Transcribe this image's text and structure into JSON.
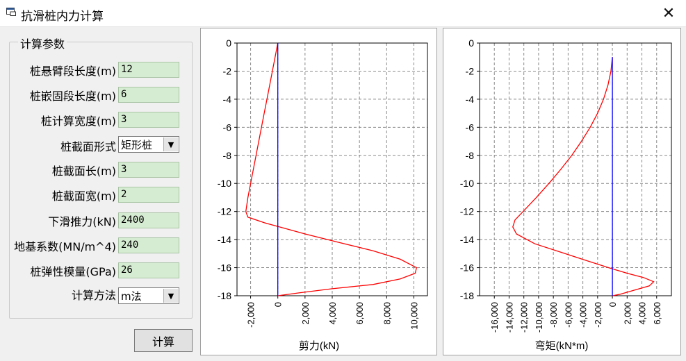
{
  "window": {
    "title": "抗滑桩内力计算",
    "close_label": "✕"
  },
  "params": {
    "group_title": "计算参数",
    "fields": [
      {
        "label": "桩悬臂段长度(m)",
        "value": "12"
      },
      {
        "label": "桩嵌固段长度(m)",
        "value": "6"
      },
      {
        "label": "桩计算宽度(m)",
        "value": "3"
      },
      {
        "label": "桩截面形式",
        "value": "矩形桩"
      },
      {
        "label": "桩截面长(m)",
        "value": "3"
      },
      {
        "label": "桩截面宽(m)",
        "value": "2"
      },
      {
        "label": "下滑推力(kN)",
        "value": "2400"
      },
      {
        "label": "地基系数(MN/m^4)",
        "value": "240"
      },
      {
        "label": "桩弹性模量(GPa)",
        "value": "26"
      },
      {
        "label": "计算方法",
        "value": "m法"
      }
    ],
    "calc_button": "计算"
  },
  "chart_data": [
    {
      "type": "line",
      "title": "",
      "xlabel": "剪力(kN)",
      "ylabel": "",
      "xlim": [
        -3000,
        11000
      ],
      "ylim": [
        -18,
        0
      ],
      "x_ticks": [
        -2000,
        0,
        2000,
        4000,
        6000,
        8000,
        10000
      ],
      "x_tick_labels": [
        "-2,000",
        "0",
        "2,000",
        "4,000",
        "6,000",
        "8,000",
        "10,000"
      ],
      "y_ticks": [
        0,
        -2,
        -4,
        -6,
        -8,
        -10,
        -12,
        -14,
        -16,
        -18
      ],
      "grid": true,
      "series": [
        {
          "color": "#ff0000",
          "points": [
            [
              0,
              0
            ],
            [
              -200,
              -1
            ],
            [
              -400,
              -2
            ],
            [
              -600,
              -3
            ],
            [
              -800,
              -4
            ],
            [
              -1000,
              -5
            ],
            [
              -1200,
              -6
            ],
            [
              -1400,
              -7
            ],
            [
              -1600,
              -8
            ],
            [
              -1800,
              -9
            ],
            [
              -2000,
              -10
            ],
            [
              -2200,
              -11
            ],
            [
              -2350,
              -12
            ],
            [
              -2200,
              -12.4
            ],
            [
              -1000,
              -12.8
            ],
            [
              500,
              -13.2
            ],
            [
              2000,
              -13.6
            ],
            [
              4500,
              -14.2
            ],
            [
              7000,
              -14.8
            ],
            [
              9000,
              -15.4
            ],
            [
              10200,
              -16.0
            ],
            [
              10100,
              -16.4
            ],
            [
              9000,
              -16.8
            ],
            [
              7000,
              -17.2
            ],
            [
              4000,
              -17.5
            ],
            [
              1500,
              -17.8
            ],
            [
              0,
              -18
            ]
          ]
        },
        {
          "color": "#0000ff",
          "points": [
            [
              0,
              0
            ],
            [
              0,
              -18
            ]
          ]
        }
      ]
    },
    {
      "type": "line",
      "title": "",
      "xlabel": "弯矩(kN*m)",
      "ylabel": "",
      "xlim": [
        -18000,
        8000
      ],
      "ylim": [
        -18,
        0
      ],
      "x_ticks": [
        -16000,
        -14000,
        -12000,
        -10000,
        -8000,
        -6000,
        -4000,
        -2000,
        0,
        2000,
        4000,
        6000
      ],
      "x_tick_labels": [
        "-16,000",
        "-14,000",
        "-12,000",
        "-10,000",
        "-8,000",
        "-6,000",
        "-4,000",
        "-2,000",
        "0",
        "2,000",
        "4,000",
        "6,000"
      ],
      "y_ticks": [
        0,
        -2,
        -4,
        -6,
        -8,
        -10,
        -12,
        -14,
        -16,
        -18
      ],
      "grid": true,
      "series": [
        {
          "color": "#ff0000",
          "points": [
            [
              0,
              -1
            ],
            [
              -200,
              -2
            ],
            [
              -600,
              -3
            ],
            [
              -1200,
              -4
            ],
            [
              -2000,
              -5
            ],
            [
              -3000,
              -6
            ],
            [
              -4200,
              -7
            ],
            [
              -5500,
              -8
            ],
            [
              -7000,
              -9
            ],
            [
              -8600,
              -10
            ],
            [
              -10300,
              -11
            ],
            [
              -12100,
              -12
            ],
            [
              -13200,
              -12.6
            ],
            [
              -13500,
              -13.1
            ],
            [
              -13000,
              -13.6
            ],
            [
              -10500,
              -14.3
            ],
            [
              -7000,
              -14.9
            ],
            [
              -3500,
              -15.5
            ],
            [
              -500,
              -16.0
            ],
            [
              2000,
              -16.4
            ],
            [
              4200,
              -16.7
            ],
            [
              5600,
              -17.0
            ],
            [
              5000,
              -17.3
            ],
            [
              3000,
              -17.6
            ],
            [
              1000,
              -17.9
            ],
            [
              0,
              -18
            ]
          ]
        },
        {
          "color": "#0000ff",
          "points": [
            [
              0,
              -1
            ],
            [
              0,
              -18
            ]
          ]
        }
      ]
    }
  ]
}
